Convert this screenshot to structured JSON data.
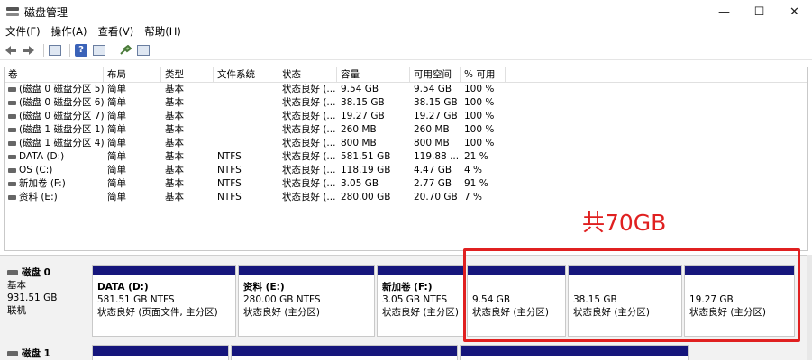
{
  "window": {
    "title": "磁盘管理",
    "minimize": "—",
    "maximize": "☐",
    "close": "✕"
  },
  "menu": [
    "文件(F)",
    "操作(A)",
    "查看(V)",
    "帮助(H)"
  ],
  "toolbar": {
    "icons": [
      "back-arrow",
      "forward-arrow",
      "panel-view",
      "help",
      "properties-view",
      "connect",
      "list-view"
    ]
  },
  "volume_table": {
    "headers": [
      "卷",
      "布局",
      "类型",
      "文件系统",
      "状态",
      "容量",
      "可用空间",
      "% 可用"
    ],
    "rows": [
      [
        "(磁盘 0 磁盘分区 5)",
        "简单",
        "基本",
        "",
        "状态良好 (...",
        "9.54 GB",
        "9.54 GB",
        "100 %"
      ],
      [
        "(磁盘 0 磁盘分区 6)",
        "简单",
        "基本",
        "",
        "状态良好 (...",
        "38.15 GB",
        "38.15 GB",
        "100 %"
      ],
      [
        "(磁盘 0 磁盘分区 7)",
        "简单",
        "基本",
        "",
        "状态良好 (...",
        "19.27 GB",
        "19.27 GB",
        "100 %"
      ],
      [
        "(磁盘 1 磁盘分区 1)",
        "简单",
        "基本",
        "",
        "状态良好 (...",
        "260 MB",
        "260 MB",
        "100 %"
      ],
      [
        "(磁盘 1 磁盘分区 4)",
        "简单",
        "基本",
        "",
        "状态良好 (...",
        "800 MB",
        "800 MB",
        "100 %"
      ],
      [
        "DATA (D:)",
        "简单",
        "基本",
        "NTFS",
        "状态良好 (...",
        "581.51 GB",
        "119.88 ...",
        "21 %"
      ],
      [
        "OS (C:)",
        "简单",
        "基本",
        "NTFS",
        "状态良好 (...",
        "118.19 GB",
        "4.47 GB",
        "4 %"
      ],
      [
        "新加卷 (F:)",
        "简单",
        "基本",
        "NTFS",
        "状态良好 (...",
        "3.05 GB",
        "2.77 GB",
        "91 %"
      ],
      [
        "资料 (E:)",
        "简单",
        "基本",
        "NTFS",
        "状态良好 (...",
        "280.00 GB",
        "20.70 GB",
        "7 %"
      ]
    ]
  },
  "disks": [
    {
      "name": "磁盘 0",
      "type": "基本",
      "size": "931.51 GB",
      "status": "联机",
      "partitions": [
        {
          "name": "DATA  (D:)",
          "size": "581.51 GB NTFS",
          "status": "状态良好 (页面文件, 主分区)"
        },
        {
          "name": "资料  (E:)",
          "size": "280.00 GB NTFS",
          "status": "状态良好 (主分区)"
        },
        {
          "name": "新加卷  (F:)",
          "size": "3.05 GB NTFS",
          "status": "状态良好 (主分区)"
        },
        {
          "name": "",
          "size": "9.54 GB",
          "status": "状态良好 (主分区)"
        },
        {
          "name": "",
          "size": "38.15 GB",
          "status": "状态良好 (主分区)"
        },
        {
          "name": "",
          "size": "19.27 GB",
          "status": "状态良好 (主分区)"
        }
      ]
    },
    {
      "name": "磁盘 1"
    }
  ],
  "annotation": {
    "text": "共70GB",
    "color": "#e02020"
  },
  "colors": {
    "partition_bar": "#16167c"
  }
}
